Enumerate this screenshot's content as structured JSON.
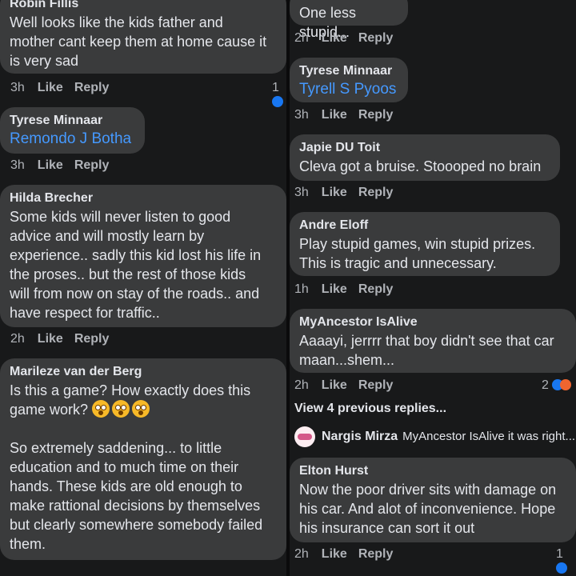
{
  "left": {
    "comments": [
      {
        "author": "Robin Fillis",
        "text": "Well looks like the kids father and\nmother cant keep them at home cause it\nis very sad",
        "time": "3h",
        "like": "Like",
        "reply": "Reply",
        "reactions": "1"
      },
      {
        "author": "Tyrese Minnaar",
        "mention": "Remondo J Botha",
        "time": "3h",
        "like": "Like",
        "reply": "Reply"
      },
      {
        "author": "Hilda Brecher",
        "text": "Some kids will never listen to good\nadvice and will mostly learn by\nexperience.. sadly this kid lost his life in\nthe proses.. but the rest of those kids\nwill from now on stay of the roads.. and\nhave respect for traffic..",
        "time": "2h",
        "like": "Like",
        "reply": "Reply"
      },
      {
        "author": "Marileze van der Berg",
        "text_line1": "Is this a game? How exactly does this",
        "text_line2": "game work?",
        "text_rest": "So extremely saddening... to little\neducation and to much time on their\nhands.  These kids are old enough to\nmake rattional decisions by themselves\nbut clearly somewhere somebody failed\nthem.",
        "emoji": "flushed-face-emoji"
      }
    ]
  },
  "right": {
    "comments": [
      {
        "text": "One less stupid...",
        "time": "2h",
        "like": "Like",
        "reply": "Reply"
      },
      {
        "author": "Tyrese Minnaar",
        "mention": "Tyrell S Pyoos",
        "time": "3h",
        "like": "Like",
        "reply": "Reply"
      },
      {
        "author": "Japie DU Toit",
        "text": "Cleva got a bruise. Stoooped no brain",
        "time": "3h",
        "like": "Like",
        "reply": "Reply"
      },
      {
        "author": "Andre Eloff",
        "text": "Play stupid games, win stupid prizes.\nThis is tragic and unnecessary.",
        "time": "1h",
        "like": "Like",
        "reply": "Reply"
      },
      {
        "author": "MyAncestor IsAlive",
        "text": "Aaaayi, jerrrr that boy didn't see that car\nmaan...shem...",
        "time": "2h",
        "like": "Like",
        "reply": "Reply",
        "reactions": "2"
      },
      {
        "author": "Elton Hurst",
        "text": "Now the poor driver sits with damage on\nhis car. And alot of inconvenience. Hope\nhis insurance can sort it out",
        "time": "2h",
        "like": "Like",
        "reply": "Reply",
        "reactions": "1"
      }
    ],
    "view_previous": "View 4 previous replies...",
    "preview_reply": {
      "author": "Nargis Mirza",
      "text": "MyAncestor IsAlive it was right..."
    }
  },
  "colors": {
    "bubble": "#3a3b3c",
    "background": "#18191a",
    "link": "#4599ff",
    "secondary_text": "#b0b3b8"
  }
}
